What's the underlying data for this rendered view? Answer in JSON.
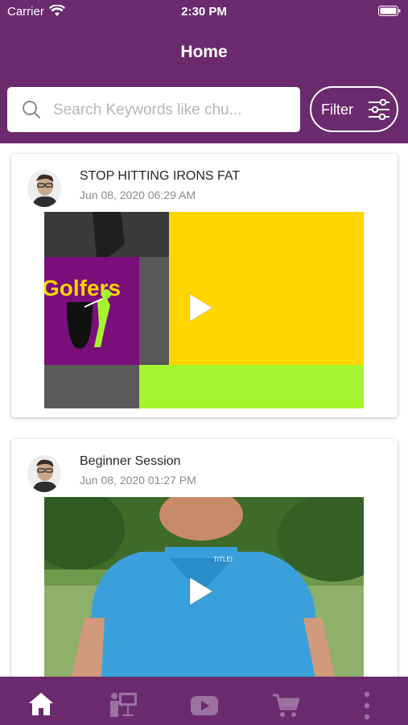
{
  "status_bar": {
    "carrier": "Carrier",
    "time": "2:30 PM"
  },
  "header": {
    "title": "Home"
  },
  "search": {
    "placeholder": "Search Keywords like chu..."
  },
  "filter": {
    "label": "Filter"
  },
  "posts": [
    {
      "title": "STOP HITTING IRONS FAT",
      "date": "Jun 08, 2020 06:29 AM",
      "thumbnail_text": "Golfers"
    },
    {
      "title": "Beginner Session",
      "date": "Jun 08, 2020 01:27 PM",
      "thumbnail_text": "TITLEI"
    }
  ],
  "tabbar": {
    "items": [
      "home-icon",
      "presentation-icon",
      "video-icon",
      "cart-icon",
      "more-icon"
    ],
    "active": "home-icon"
  },
  "colors": {
    "brand": "#6b2a6e",
    "active_tab": "#ffffff",
    "inactive_tab": "#9b72a0",
    "thumb_yellow": "#ffd600",
    "thumb_green": "#a4f52f",
    "thumb_purple": "#8b0a8a"
  }
}
